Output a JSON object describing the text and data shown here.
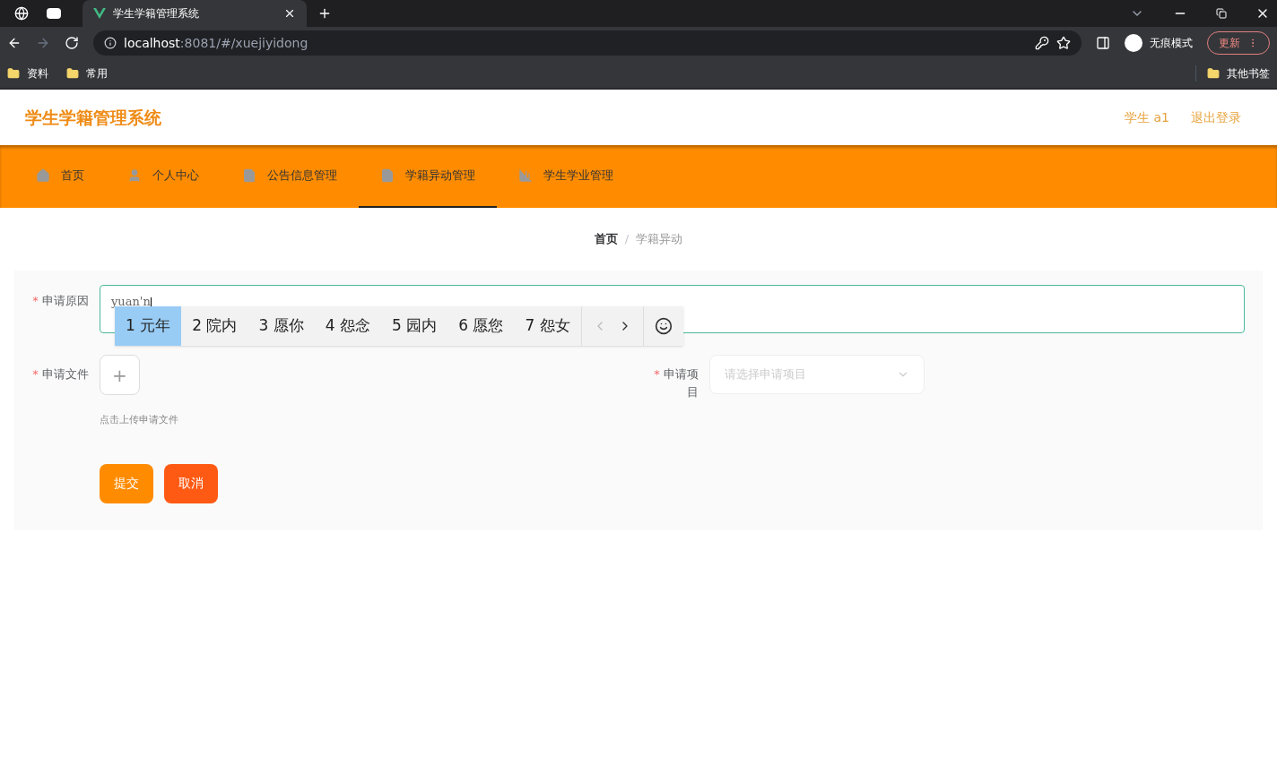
{
  "browser": {
    "tab_title": "学生学籍管理系统",
    "url_host": "localhost",
    "url_rest": ":8081/#/xuejiyidong",
    "profile": "无痕模式",
    "update": "更新",
    "bookmarks": [
      "资料",
      "常用"
    ],
    "other_bookmarks": "其他书签"
  },
  "header": {
    "title": "学生学籍管理系统",
    "user": "学生 a1",
    "logout": "退出登录"
  },
  "nav": [
    {
      "label": "首页",
      "kind": "home",
      "selected": false
    },
    {
      "label": "个人中心",
      "kind": "user",
      "selected": false
    },
    {
      "label": "公告信息管理",
      "kind": "doc",
      "selected": false
    },
    {
      "label": "学籍异动管理",
      "kind": "doc",
      "selected": true
    },
    {
      "label": "学生学业管理",
      "kind": "chart",
      "selected": false
    }
  ],
  "breadcrumb": {
    "home": "首页",
    "separator": "/",
    "current": "学籍异动"
  },
  "form": {
    "required_mark": "*",
    "reason_label": "申请原因",
    "reason_value": "yuan'n",
    "file_label": "申请文件",
    "upload_symbol": "+",
    "upload_hint": "点击上传申请文件",
    "item_label": "申请项目",
    "item_placeholder": "请选择申请项目",
    "submit": "提交",
    "cancel": "取消"
  },
  "ime": {
    "candidates": [
      {
        "text": "1 元年",
        "selected": true
      },
      {
        "text": "2 院内",
        "selected": false
      },
      {
        "text": "3 愿你",
        "selected": false
      },
      {
        "text": "4 怨念",
        "selected": false
      },
      {
        "text": "5 园内",
        "selected": false
      },
      {
        "text": "6 愿您",
        "selected": false
      },
      {
        "text": "7 怨女",
        "selected": false
      }
    ]
  }
}
